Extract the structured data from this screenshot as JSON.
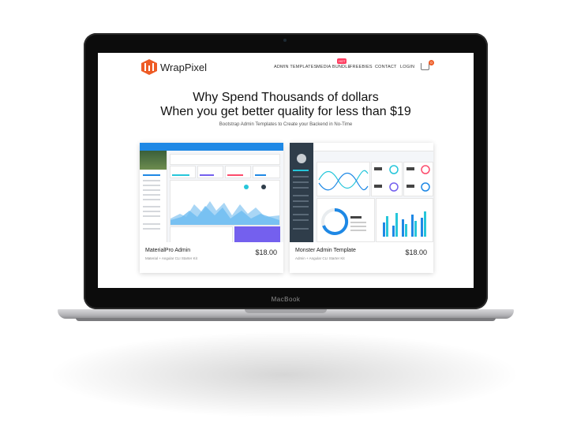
{
  "device": {
    "brand_label": "MacBook"
  },
  "site": {
    "logo_text": "WrapPixel",
    "nav": {
      "items": [
        "ADMIN TEMPLATES",
        "MEDIA BUNDLE",
        "FREEBIES",
        "CONTACT",
        "LOGIN"
      ],
      "hot_badge": "HOT",
      "cart_count": "0"
    },
    "hero": {
      "title_line1": "Why Spend Thousands of dollars",
      "title_line2": "When you get better quality for less than $19",
      "subtitle": "Bootstrap Admin Templates to Create your Backend in No-Time"
    },
    "products": [
      {
        "name": "MaterialPro Admin",
        "desc": "Material + Angular CLI Starter Kit",
        "price": "$18.00"
      },
      {
        "name": "Monster Admin Template",
        "desc": "Admin + Angular CLI Starter Kit",
        "price": "$18.00"
      }
    ]
  },
  "colors": {
    "accent": "#ee5b25",
    "hot": "#ff3c5f",
    "materialpro_blue": "#1e88e5",
    "monster_dark": "#2f3d4a"
  },
  "icons": [
    "wrappixel-logo-icon",
    "cart-icon"
  ]
}
